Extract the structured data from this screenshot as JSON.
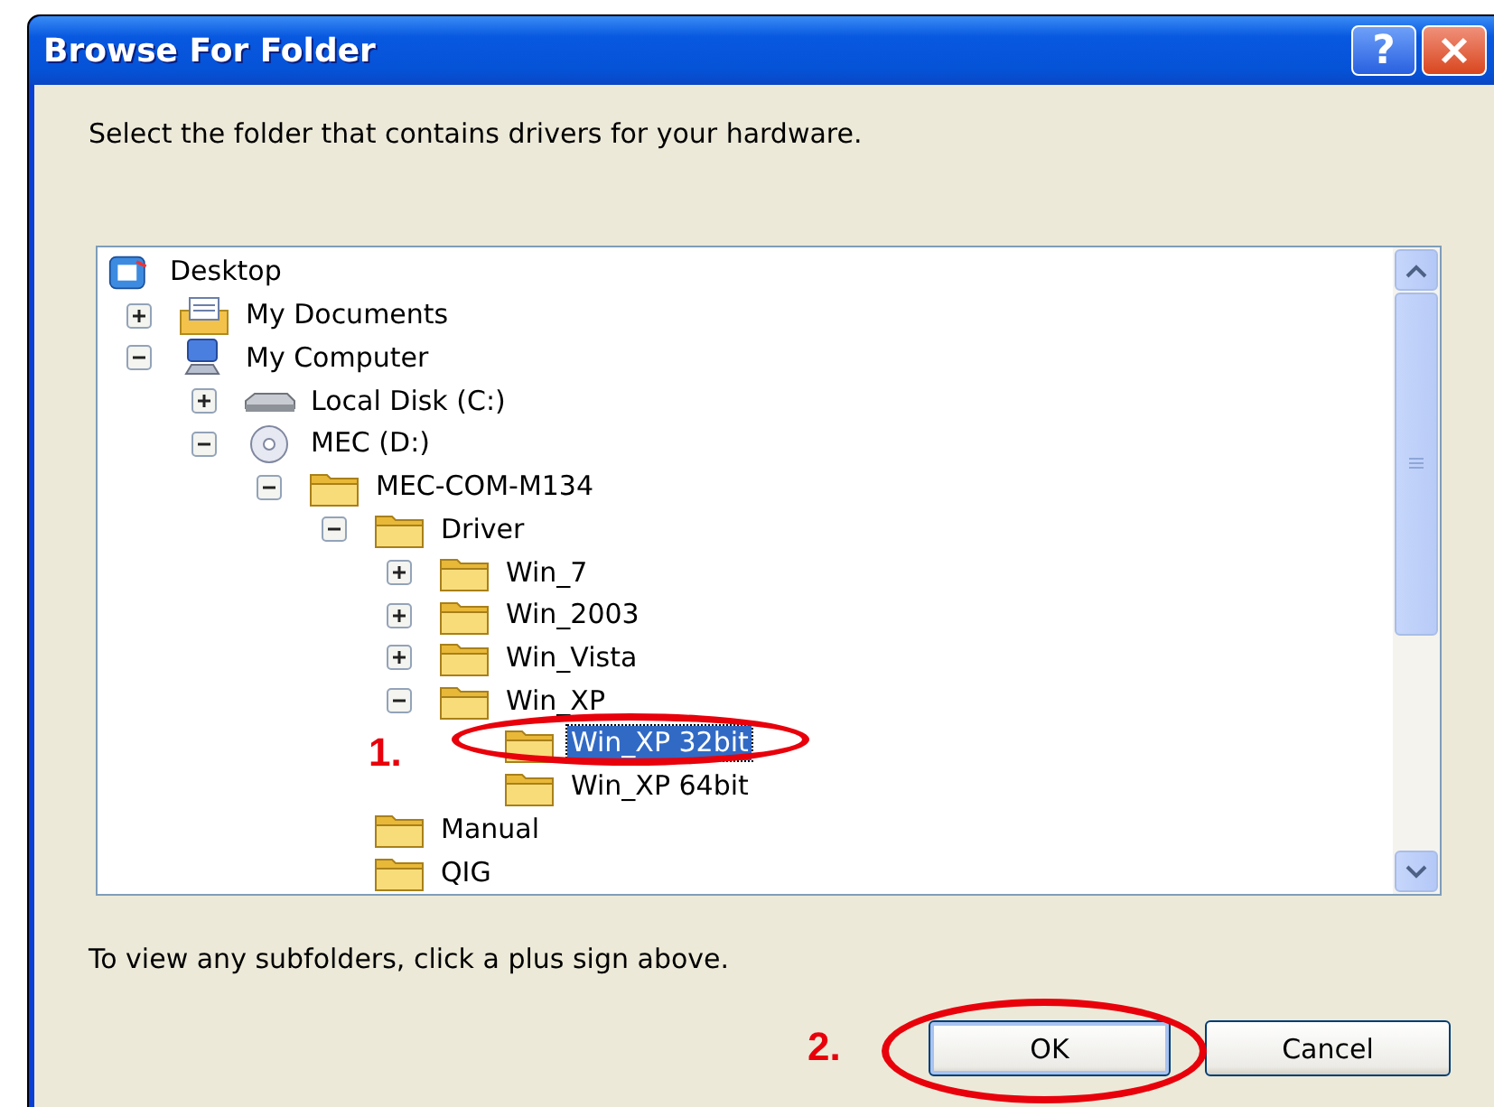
{
  "window": {
    "title": "Browse For Folder",
    "help_button": "?"
  },
  "instruction": "Select the folder that contains drivers for your hardware.",
  "tree": [
    {
      "label": "Desktop",
      "selected": false,
      "children": [
        {
          "label": "My Documents",
          "expanded": false,
          "selected": false
        },
        {
          "label": "My Computer",
          "expanded": true,
          "selected": false,
          "children": [
            {
              "label": "Local Disk (C:)",
              "expanded": false,
              "selected": false
            },
            {
              "label": "MEC (D:)",
              "expanded": true,
              "selected": false,
              "children": [
                {
                  "label": "MEC-COM-M134",
                  "expanded": true,
                  "selected": false,
                  "children": [
                    {
                      "label": "Driver",
                      "expanded": true,
                      "selected": false,
                      "children": [
                        {
                          "label": "Win_7",
                          "expanded": false,
                          "selected": false
                        },
                        {
                          "label": "Win_2003",
                          "expanded": false,
                          "selected": false
                        },
                        {
                          "label": "Win_Vista",
                          "expanded": false,
                          "selected": false
                        },
                        {
                          "label": "Win_XP",
                          "expanded": true,
                          "selected": false,
                          "children": [
                            {
                              "label": "Win_XP 32bit",
                              "selected": true
                            },
                            {
                              "label": "Win_XP 64bit",
                              "selected": false
                            }
                          ]
                        }
                      ]
                    },
                    {
                      "label": "Manual",
                      "selected": false
                    },
                    {
                      "label": "QIG",
                      "selected": false
                    }
                  ]
                }
              ]
            }
          ]
        }
      ]
    }
  ],
  "hint": "To view any subfolders, click a plus sign above.",
  "buttons": [
    {
      "label": "OK",
      "kind": "default"
    },
    {
      "label": "Cancel",
      "kind": "normal"
    }
  ],
  "annotations": [
    {
      "label": "1."
    },
    {
      "label": "2."
    }
  ]
}
